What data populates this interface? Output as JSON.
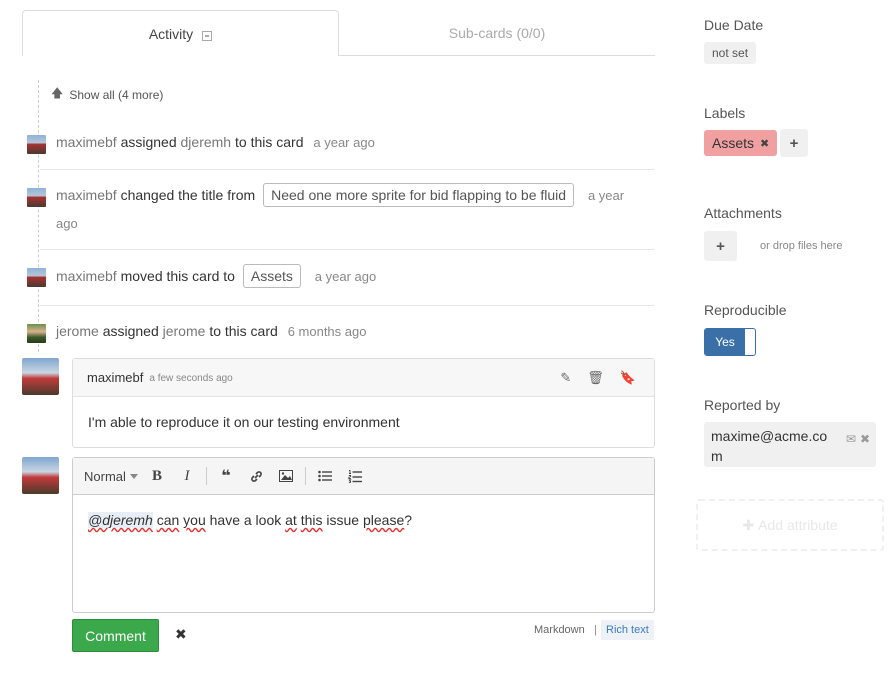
{
  "tabs": [
    {
      "label": "Activity",
      "active": true
    },
    {
      "label": "Sub-cards (0/0)",
      "active": false
    }
  ],
  "timeline": {
    "show_all": "Show all (4 more)",
    "entries": [
      {
        "user": "maximebf",
        "action": "assigned",
        "target": "djeremh",
        "suffix": "to this card",
        "time": "a year ago"
      },
      {
        "user": "maximebf",
        "action": "changed the title from",
        "target": "Need one more sprite for bid flapping to be fluid",
        "time_part1": "a year",
        "time_part2": "ago"
      },
      {
        "user": "maximebf",
        "action": "moved this card to",
        "target": "Assets",
        "time": "a year ago"
      },
      {
        "user": "jerome",
        "action": "assigned",
        "target": "jerome",
        "suffix": "to this card",
        "time": "6 months ago"
      }
    ]
  },
  "comment": {
    "author": "maximebf",
    "time": "a few seconds ago",
    "body": "I'm able to reproduce it on our testing environment"
  },
  "editor": {
    "format": "Normal",
    "text": {
      "mention": "@djeremh",
      "w1": "can",
      "w2": "you",
      "w3": "have a look",
      "w4": "at",
      "w5": "this",
      "w6": "issue",
      "w7": "please",
      "end": "?"
    },
    "submit_label": "Comment",
    "mode_markdown": "Markdown",
    "mode_separator": "|",
    "mode_richtext": "Rich text"
  },
  "panel": {
    "due_date_label": "Due Date",
    "due_date_value": "not set",
    "labels_label": "Labels",
    "label_assets": "Assets",
    "attachments_label": "Attachments",
    "drop_hint": "or drop files here",
    "reproducible_label": "Reproducible",
    "reproducible_value": "Yes",
    "reported_by_label": "Reported by",
    "reported_by_value": "maxime@acme.com",
    "add_attribute": "Add attribute"
  },
  "colors": {
    "accent_green": "#3aa84b",
    "label_assets": "#f0a0a0",
    "toggle_blue": "#3b6fa8"
  }
}
